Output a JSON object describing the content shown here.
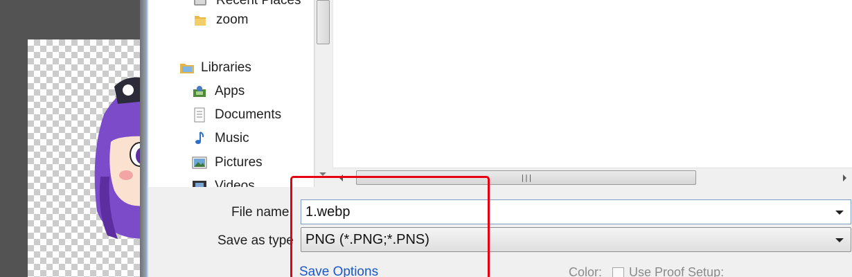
{
  "nav": {
    "items": [
      {
        "label": "Recent Places",
        "icon": "recent-places-icon"
      },
      {
        "label": "zoom",
        "icon": "folder-icon"
      },
      {
        "label": "Libraries",
        "icon": "libraries-icon"
      },
      {
        "label": "Apps",
        "icon": "apps-library-icon"
      },
      {
        "label": "Documents",
        "icon": "documents-icon"
      },
      {
        "label": "Music",
        "icon": "music-icon"
      },
      {
        "label": "Pictures",
        "icon": "pictures-icon"
      },
      {
        "label": "Videos",
        "icon": "videos-icon"
      }
    ]
  },
  "form": {
    "file_name_label": "File name",
    "file_name_value": "1.webp",
    "save_as_type_label": "Save as type",
    "save_as_type_value": "PNG (*.PNG;*.PNS)",
    "save_options_label": "Save Options",
    "color_label": "Color:",
    "use_proof_setup_label": "Use Proof Setup:"
  },
  "colors": {
    "highlight": "#e60012",
    "link": "#1a58c4"
  }
}
